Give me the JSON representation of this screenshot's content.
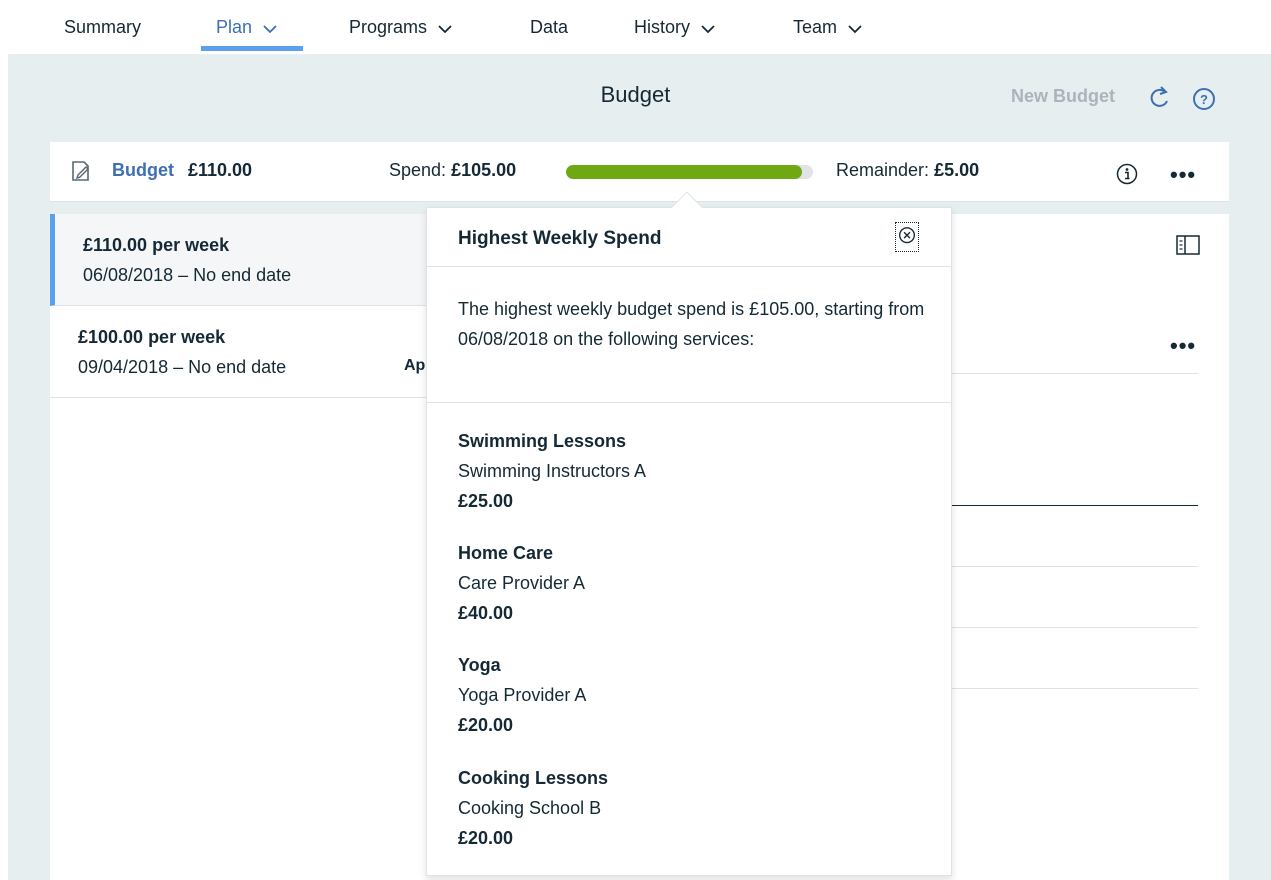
{
  "nav": {
    "tabs": [
      {
        "label": "Summary",
        "has_menu": false
      },
      {
        "label": "Plan",
        "has_menu": true,
        "active": true
      },
      {
        "label": "Programs",
        "has_menu": true
      },
      {
        "label": "Data",
        "has_menu": false
      },
      {
        "label": "History",
        "has_menu": true
      },
      {
        "label": "Team",
        "has_menu": true
      }
    ]
  },
  "header": {
    "title": "Budget",
    "new_budget_label": "New Budget",
    "refresh_icon": "refresh-icon",
    "help_icon": "help-icon"
  },
  "summary": {
    "budget_link": "Budget",
    "budget_amount": "£110.00",
    "spend_label": "Spend:",
    "spend_amount": "£105.00",
    "spend_fraction": 0.955,
    "remainder_label": "Remainder:",
    "remainder_amount": "£5.00",
    "info_icon": "info-icon",
    "overflow_label": "•••"
  },
  "budget_list": [
    {
      "title": "£110.00 per week",
      "dates": "06/08/2018 – No end date",
      "status": ""
    },
    {
      "title": "£100.00 per week",
      "dates": "09/04/2018 – No end date",
      "status": "Ap"
    }
  ],
  "detail": {
    "overflow_label": "•••",
    "panel_icon": "panel-toggle-icon"
  },
  "popover": {
    "title": "Highest Weekly Spend",
    "description": "The highest weekly budget spend is £105.00, starting from 06/08/2018 on the following services:",
    "services": [
      {
        "name": "Swimming Lessons",
        "provider": "Swimming Instructors A",
        "cost": "£25.00"
      },
      {
        "name": "Home Care",
        "provider": "Care Provider A",
        "cost": "£40.00"
      },
      {
        "name": "Yoga",
        "provider": "Yoga Provider A",
        "cost": "£20.00"
      },
      {
        "name": "Cooking Lessons",
        "provider": "Cooking School B",
        "cost": "£20.00"
      }
    ]
  },
  "colors": {
    "accent_blue": "#3d70b2",
    "tab_underline": "#5aa0ec",
    "progress_green": "#6ea813",
    "page_background": "#e6eef0"
  }
}
